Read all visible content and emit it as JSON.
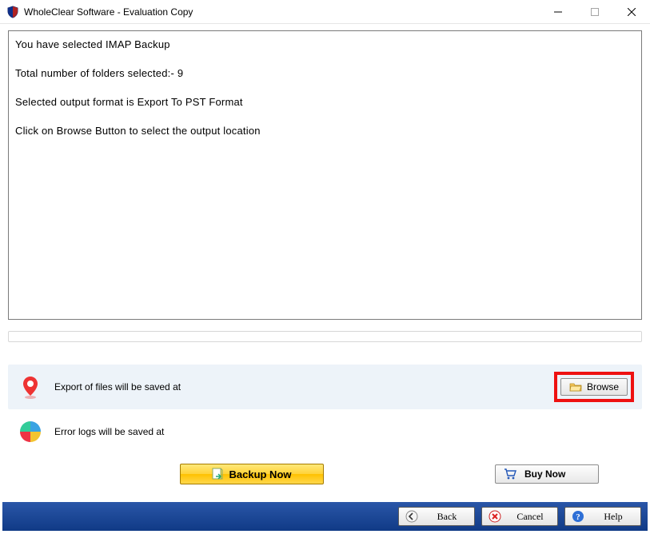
{
  "window": {
    "title": "WholeClear Software - Evaluation Copy"
  },
  "info": {
    "l1": "You have selected IMAP Backup",
    "l2": "Total number of folders selected:- 9",
    "l3": "Selected output format is Export To PST Format",
    "l4": "Click on Browse Button to select the output location"
  },
  "rows": {
    "export_label": "Export of files will be saved at",
    "errors_label": "Error logs will be saved at",
    "browse_label": "Browse"
  },
  "actions": {
    "backup_now": "Backup Now",
    "buy_now": "Buy Now"
  },
  "footer": {
    "back": "Back",
    "cancel": "Cancel",
    "help": "Help"
  }
}
